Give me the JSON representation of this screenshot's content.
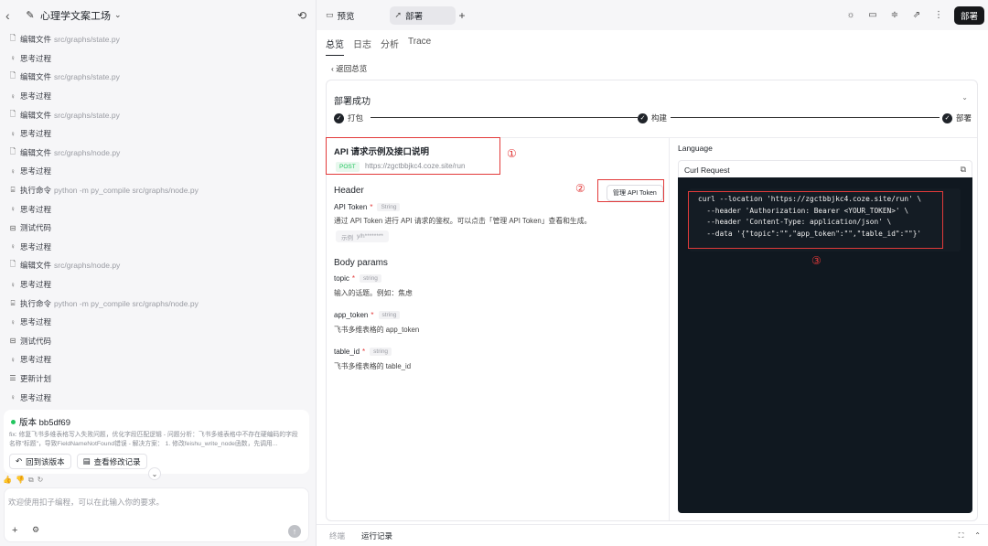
{
  "left": {
    "header": {
      "back_icon": "chevron-left-icon",
      "title": "心理学文案工场",
      "chevron": "chevron-down-icon",
      "history_icon": "history-icon"
    },
    "steps": [
      {
        "icon": "file-icon",
        "label": "编辑文件",
        "path": "src/graphs/state.py"
      },
      {
        "icon": "bulb-icon",
        "label": "思考过程",
        "path": ""
      },
      {
        "icon": "file-icon",
        "label": "编辑文件",
        "path": "src/graphs/state.py"
      },
      {
        "icon": "bulb-icon",
        "label": "思考过程",
        "path": ""
      },
      {
        "icon": "file-icon",
        "label": "编辑文件",
        "path": "src/graphs/state.py"
      },
      {
        "icon": "bulb-icon",
        "label": "思考过程",
        "path": ""
      },
      {
        "icon": "file-icon",
        "label": "编辑文件",
        "path": "src/graphs/node.py"
      },
      {
        "icon": "bulb-icon",
        "label": "思考过程",
        "path": ""
      },
      {
        "icon": "terminal-icon",
        "label": "执行命令",
        "path": "python -m py_compile src/graphs/node.py"
      },
      {
        "icon": "bulb-icon",
        "label": "思考过程",
        "path": ""
      },
      {
        "icon": "test-icon",
        "label": "测试代码",
        "path": ""
      },
      {
        "icon": "bulb-icon",
        "label": "思考过程",
        "path": ""
      },
      {
        "icon": "file-icon",
        "label": "编辑文件",
        "path": "src/graphs/node.py"
      },
      {
        "icon": "bulb-icon",
        "label": "思考过程",
        "path": ""
      },
      {
        "icon": "terminal-icon",
        "label": "执行命令",
        "path": "python -m py_compile src/graphs/node.py"
      },
      {
        "icon": "bulb-icon",
        "label": "思考过程",
        "path": ""
      },
      {
        "icon": "test-icon",
        "label": "测试代码",
        "path": ""
      },
      {
        "icon": "bulb-icon",
        "label": "思考过程",
        "path": ""
      },
      {
        "icon": "plan-icon",
        "label": "更新计划",
        "path": ""
      },
      {
        "icon": "bulb-icon",
        "label": "思考过程",
        "path": ""
      }
    ],
    "version": {
      "title": "版本 bb5df69",
      "desc": "fix: 修复飞书多维表格写入失败问题，优化字段匹配逻辑 - 问题分析：飞书多维表格中不存在硬编码的字段名称\"标题\"，导致FieldNameNotFound错误 - 解决方案： 1. 修改feishu_write_node函数，先调用...",
      "restore": "回到该版本",
      "view_changes": "查看修改记录"
    },
    "input": {
      "placeholder": "欢迎使用扣子编程，可以在此输入你的要求。"
    }
  },
  "topbar": {
    "tabs": [
      {
        "icon": "preview-icon",
        "label": "预览"
      },
      {
        "icon": "rocket-icon",
        "label": "部署"
      }
    ],
    "deploy_button": "部署"
  },
  "subtabs": [
    "总览",
    "日志",
    "分析",
    "Trace"
  ],
  "back_link": "返回总览",
  "deploy": {
    "status": "部署成功",
    "stages": [
      "打包",
      "构建",
      "部署"
    ]
  },
  "api": {
    "heading": "API 请求示例及接口说明",
    "method": "POST",
    "url": "https://zgctbbjkc4.coze.site/run",
    "manage_token": "管理 API Token",
    "header_title": "Header",
    "token_name": "API Token",
    "token_type": "String",
    "token_desc": "通过 API Token 进行 API 请求的鉴权。可以点击「管理 API Token」查看和生成。",
    "example_label": "示例",
    "example_value": "y/h********",
    "body_title": "Body params",
    "params": [
      {
        "name": "topic",
        "type": "string",
        "desc": "输入的话题。例如：焦虑"
      },
      {
        "name": "app_token",
        "type": "string",
        "desc": "飞书多维表格的 app_token"
      },
      {
        "name": "table_id",
        "type": "string",
        "desc": "飞书多维表格的 table_id"
      }
    ]
  },
  "language_label": "Language",
  "curl_label": "Curl Request",
  "code_lines": [
    "curl --location 'https://zgctbbjkc4.coze.site/run' \\",
    "  --header 'Authorization: Bearer <YOUR_TOKEN>' \\",
    "  --header 'Content-Type: application/json' \\",
    "  --data '{\"topic\":\"\",\"app_token\":\"\",\"table_id\":\"\"}'"
  ],
  "markers": [
    "①",
    "②",
    "③"
  ],
  "bottom_tabs": [
    "终端",
    "运行记录"
  ],
  "colors": {
    "accent": "#16171a",
    "success": "#22c55e",
    "annotation": "#e23a3a",
    "code_bg": "#101820"
  }
}
